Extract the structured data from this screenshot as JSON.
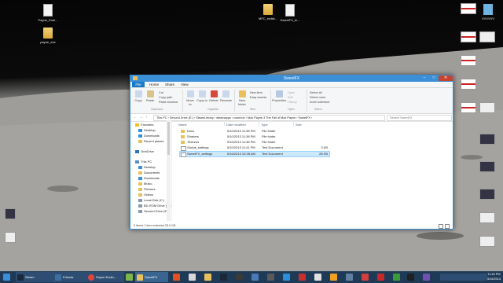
{
  "desktop": {
    "icons": [
      {
        "label": "Payne_Endi...",
        "kind": "file"
      },
      {
        "label": "payne_exe",
        "kind": "folder"
      },
      {
        "label": "MFC_redist...",
        "kind": "file"
      },
      {
        "label": "SweetFX_le...",
        "kind": "file"
      },
      {
        "label": "VVVVVV",
        "kind": "file"
      }
    ]
  },
  "window": {
    "title": "SweetFX",
    "ribbon_tabs": [
      "File",
      "Home",
      "Share",
      "View"
    ],
    "ribbon": {
      "copy": "Copy",
      "paste": "Paste",
      "cut": "Cut",
      "copy_path": "Copy path",
      "paste_shortcut": "Paste shortcut",
      "move_to": "Move to",
      "copy_to": "Copy to",
      "delete": "Delete",
      "rename": "Rename",
      "new_folder": "New folder",
      "new_item": "New item",
      "easy_access": "Easy access",
      "properties": "Properties",
      "open": "Open",
      "edit": "Edit",
      "history": "History",
      "select_all": "Select all",
      "select_none": "Select none",
      "invert_selection": "Invert selection",
      "groups": [
        "Clipboard",
        "Organize",
        "New",
        "Open",
        "Select"
      ]
    },
    "address": {
      "path": "This PC  ›  Second Drive (E:)  ›  SteamLibrary  ›  steamapps  ›  common  ›  Max Payne 3 The Fall of Max Payne  ›  SweetFX  ›",
      "search_placeholder": "Search SweetFX"
    },
    "nav": {
      "favorites": "Favorites",
      "fav_items": [
        "Desktop",
        "Downloads",
        "Recent places"
      ],
      "onedrive": "OneDrive",
      "this_pc": "This PC",
      "pc_items": [
        "Desktop",
        "Documents",
        "Downloads",
        "Music",
        "Pictures",
        "Videos",
        "Local Disk (C:)",
        "BD-ROM Drive (D:)",
        "Second Drive (E:)"
      ]
    },
    "columns": [
      "Name",
      "Date modified",
      "Type",
      "Size"
    ],
    "files": [
      {
        "name": "Docs",
        "date": "5/10/2013 11:38 PM",
        "type": "File folder",
        "size": "",
        "kind": "folder",
        "selected": false
      },
      {
        "name": "Shaders",
        "date": "5/10/2013 11:38 PM",
        "type": "File folder",
        "size": "",
        "kind": "folder",
        "selected": false
      },
      {
        "name": "Textures",
        "date": "5/10/2013 11:38 PM",
        "type": "File folder",
        "size": "",
        "kind": "folder",
        "selected": false
      },
      {
        "name": "Global_settings",
        "date": "5/10/2013 11:41 PM",
        "type": "Text Document",
        "size": "3 KB",
        "kind": "text",
        "selected": false
      },
      {
        "name": "SweetFX_settings",
        "date": "5/16/2013 10:28 AM",
        "type": "Text Document",
        "size": "28 KB",
        "kind": "text",
        "selected": true
      }
    ],
    "status": "5 items    1 item selected  25.9 KB"
  },
  "taskbar": {
    "items": [
      {
        "label": "Steam",
        "color": "#1b2838"
      },
      {
        "label": "Friends",
        "color": "#3d6f9e"
      },
      {
        "label": "Payne Endin...",
        "color": "#e0463a"
      },
      {
        "label": "SweetFX",
        "color": "#e8c15c"
      }
    ],
    "time": "11:40 PM",
    "date": "5/16/2013"
  },
  "colors": {
    "accent": "#3b8fd6",
    "selection": "#cce8ff",
    "close": "#c7432f"
  }
}
